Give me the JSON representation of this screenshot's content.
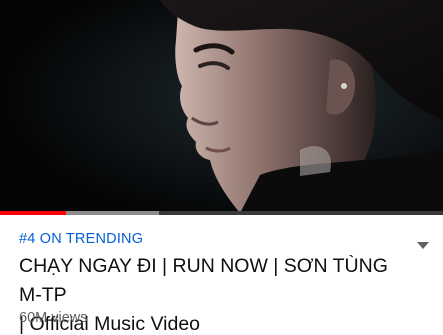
{
  "video": {
    "progress_played": 0.15,
    "progress_buffered": 0.36,
    "colors": {
      "played": "#ff0000",
      "buffered": "#8d8d8d",
      "track": "#3a3a3a"
    }
  },
  "details": {
    "trending_label": "#4 ON TRENDING",
    "title_line1": "CHẠY NGAY ĐI | RUN NOW | SƠN TÙNG M-TP",
    "title_line2": "| Official Music Video",
    "views": "60M views",
    "expand_icon": "chevron-down-icon"
  },
  "colors": {
    "trending": "#065fd4",
    "title": "#0f0f0f",
    "views": "#606060"
  }
}
